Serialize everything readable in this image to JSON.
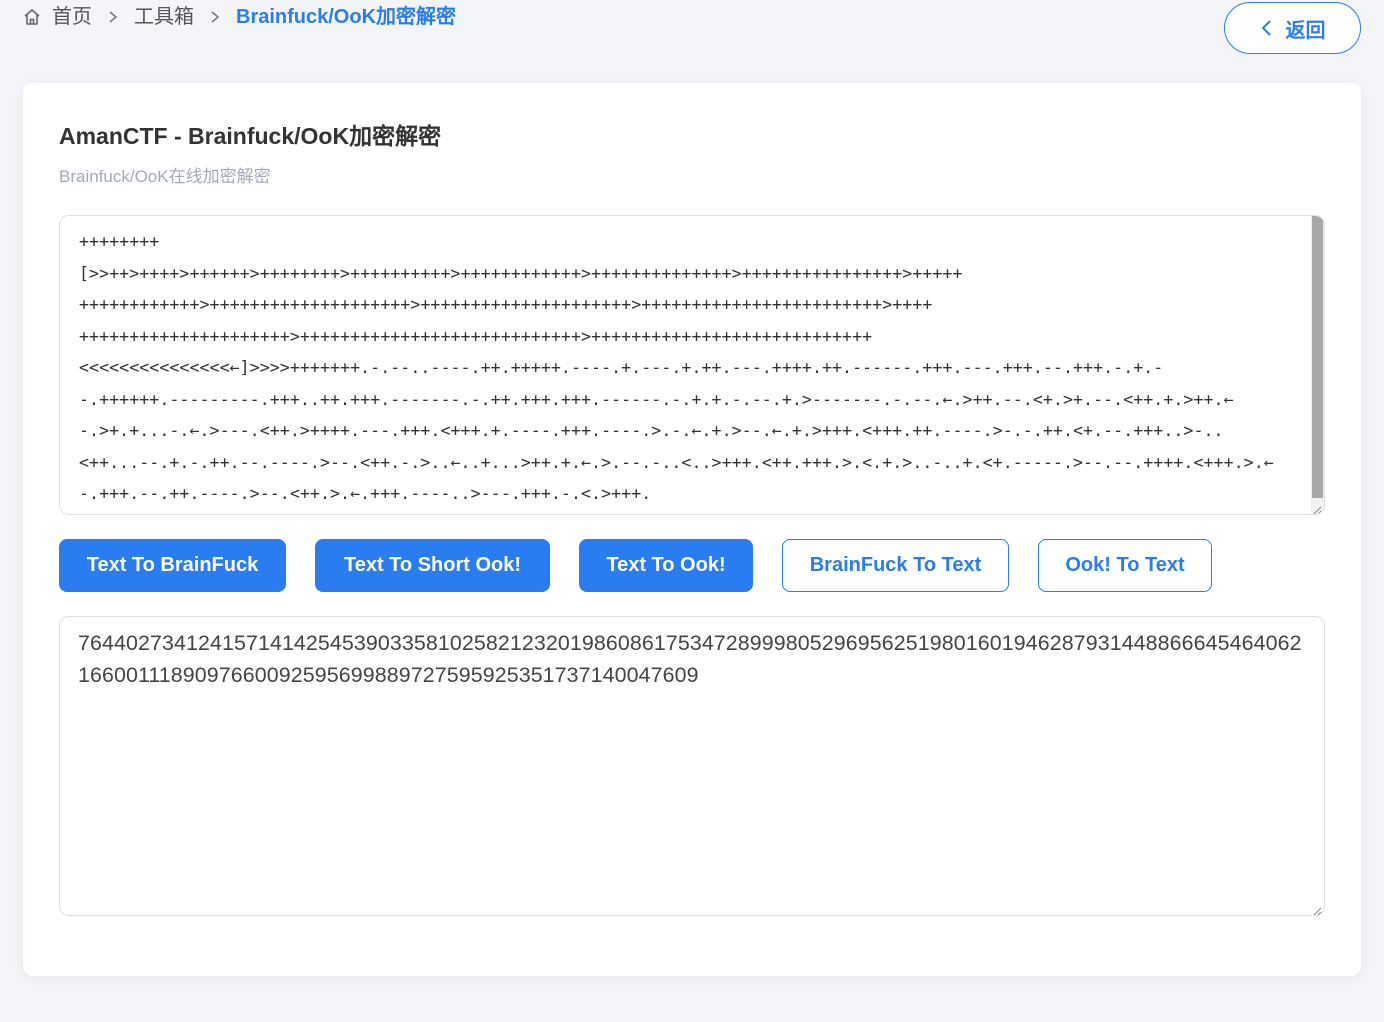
{
  "breadcrumb": {
    "home": "首页",
    "toolbox": "工具箱",
    "current": "Brainfuck/OoK加密解密"
  },
  "back_button": {
    "label": "返回"
  },
  "card": {
    "title": "AmanCTF - Brainfuck/OoK加密解密",
    "subtitle": "Brainfuck/OoK在线加密解密"
  },
  "input": {
    "lines": [
      "++++++++",
      "[>>++>++++>++++++>++++++++>++++++++++>++++++++++++>++++++++++++++>++++++++++++++++>+++++",
      "++++++++++++>++++++++++++++++++++>+++++++++++++++++++++>++++++++++++++++++++++++>++++",
      "+++++++++++++++++++++>++++++++++++++++++++++++++++>++++++++++++++++++++++++++++",
      "<<<<<<<<<<<<<<<←]>>>>+++++++.-.--..----.++.+++++.----.+.---.+.++.---.++++.++.------.+++.---.+++.--.+++.-.+.-",
      "-.++++++.---------.+++..++.+++.-------.-.++.+++.+++.------.-.+.+.-.--.+.>-------.-.--.←.>++.--.<+.>+.--.<++.+.>++.←",
      "-.>+.+...-.←.>---.<++.>++++.---.+++.<+++.+.----.+++.----.>.-.←.+.>--.←.+.>+++.<+++.++.----.>-.-.++.<+.--.+++..>-..",
      "<++...--.+.-.++.--.----.>--.<++.-.>..←..+...>++.+.←.>.--.-..<..>+++.<++.+++.>.<.+.>..-..+.<+.-----.>--.--.++++.<+++.>.←",
      "-.+++.--.++.----.>--.<++.>.←.+++.----..>---.+++.-.<.>+++."
    ]
  },
  "buttons": [
    {
      "label": "Text To BrainFuck",
      "style": "primary"
    },
    {
      "label": "Text To Short Ook!",
      "style": "primary"
    },
    {
      "label": "Text To Ook!",
      "style": "primary"
    },
    {
      "label": "BrainFuck To Text",
      "style": "outline"
    },
    {
      "label": "Ook! To Text",
      "style": "outline"
    }
  ],
  "output": {
    "value": "7644027341241571414254539033581025821232019860861753472899980529695625198016019462879314488666454640621660011189097660092595699889727595925351737140047609"
  },
  "colors": {
    "accent": "#2a7df0",
    "background": "#f3f5f8",
    "card": "#ffffff",
    "subtitle": "#a3a9b8",
    "border": "#dcdfe6"
  },
  "icons": {
    "home": "home-icon",
    "separator": "chevron-right-icon",
    "back": "chevron-left-icon"
  }
}
